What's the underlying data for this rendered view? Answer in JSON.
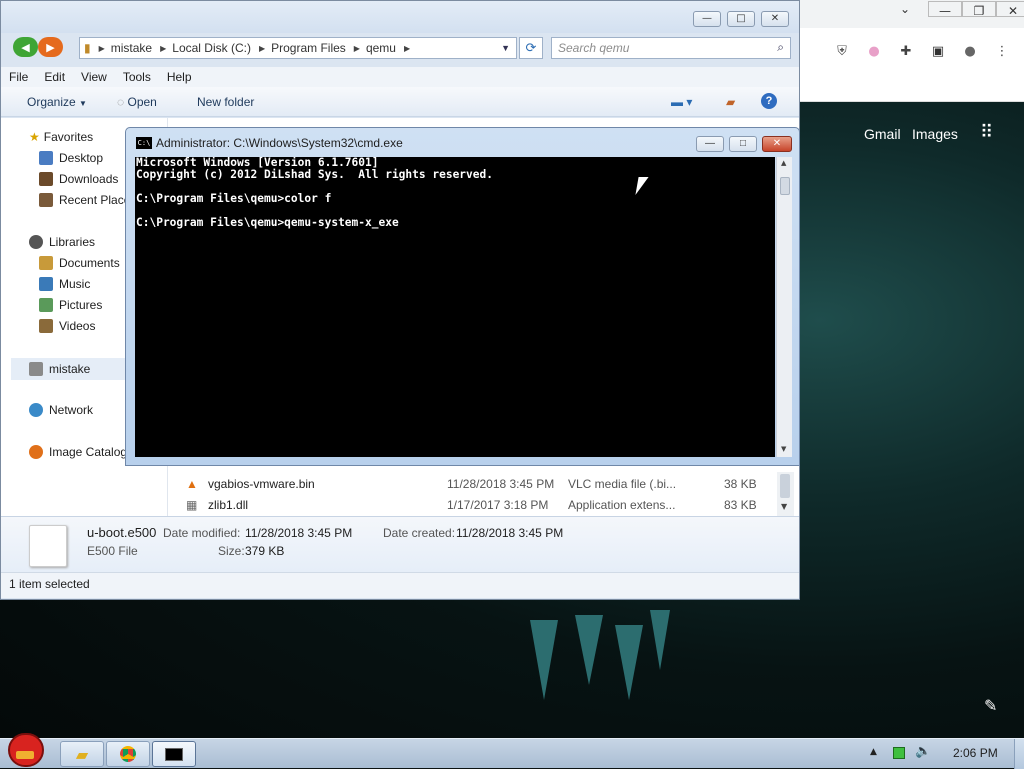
{
  "explorer": {
    "nav_back": "◀",
    "nav_forward": "▶",
    "address": [
      "mistake",
      "Local Disk (C:)",
      "Program Files",
      "qemu"
    ],
    "search_placeholder": "Search qemu",
    "caption_buttons": {
      "minimize": "—",
      "maximize": "□",
      "close": "✕"
    },
    "menu": [
      "File",
      "Edit",
      "View",
      "Tools",
      "Help"
    ],
    "commands": {
      "organize": "Organize",
      "open": "Open",
      "new_folder": "New folder"
    },
    "nav_pane": {
      "favorites": {
        "label": "Favorites",
        "items": [
          "Desktop",
          "Downloads",
          "Recent Places"
        ]
      },
      "libraries": {
        "label": "Libraries",
        "items": [
          "Documents",
          "Music",
          "Pictures",
          "Videos"
        ]
      },
      "homegroup": "mistake",
      "network": "Network",
      "image_catalog": "Image Catalog"
    },
    "files": [
      {
        "name": "vgabios-vmware.bin",
        "date": "11/28/2018 3:45 PM",
        "type": "VLC media file (.bi...",
        "size": "38 KB"
      },
      {
        "name": "zlib1.dll",
        "date": "1/17/2017 3:18 PM",
        "type": "Application extens...",
        "size": "83 KB"
      }
    ],
    "details": {
      "name": "u-boot.e500",
      "type": "E500 File",
      "modified_label": "Date modified:",
      "modified": "11/28/2018 3:45 PM",
      "created_label": "Date created:",
      "created": "11/28/2018 3:45 PM",
      "size_label": "Size:",
      "size": "379 KB"
    },
    "status": "1 item selected"
  },
  "cmd": {
    "title": "Administrator: C:\\Windows\\System32\\cmd.exe",
    "icon_text": "C:\\",
    "lines": [
      "Microsoft Windows [Version 6.1.7601]",
      "Copyright (c) 2012 DiLshad Sys.  All rights reserved.",
      "",
      "C:\\Program Files\\qemu>color f",
      "",
      "C:\\Program Files\\qemu>qemu-system-x_exe"
    ]
  },
  "chrome": {
    "links": [
      "Gmail",
      "Images"
    ]
  },
  "taskbar": {
    "clock": "2:06 PM"
  },
  "colors": {
    "explorer_frame": "#dbe5f1",
    "cmd_bg": "#000000",
    "taskbar": "#b6c8dc",
    "desktop_teal": "#2c6d6f"
  }
}
